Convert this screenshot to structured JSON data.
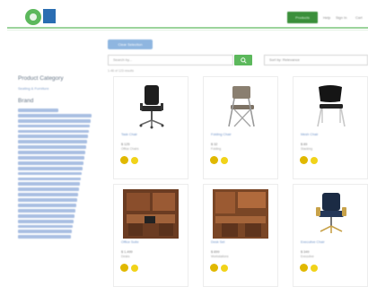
{
  "header": {
    "nav": [
      "Products",
      "Help",
      "Sign In",
      "Cart"
    ]
  },
  "sidebar": {
    "category_title": "Product Category",
    "category_sub": "Seating & Furniture",
    "brand_title": "Brand",
    "brand_items": 25
  },
  "controls": {
    "filter_chip": "Clear Selection",
    "search_placeholder": "Search by...",
    "search_button": "Go",
    "sort_label": "Sort by: Relevance",
    "results_text": "1-48 of 123 results"
  },
  "products": [
    {
      "title": "Task Chair",
      "price": "$ 125",
      "meta": "Office Chairs"
    },
    {
      "title": "Folding Chair",
      "price": "$ 32",
      "meta": "Folding"
    },
    {
      "title": "Mesh Chair",
      "price": "$ 89",
      "meta": "Stacking"
    },
    {
      "title": "Office Suite",
      "price": "$ 1,499",
      "meta": "Desks"
    },
    {
      "title": "Desk Set",
      "price": "$ 899",
      "meta": "Workstations"
    },
    {
      "title": "Executive Chair",
      "price": "$ 349",
      "meta": "Executive"
    }
  ],
  "colors": {
    "accent_green": "#5cb85c",
    "link_blue": "#6f93c8",
    "badge_yellow": "#e0b800"
  }
}
